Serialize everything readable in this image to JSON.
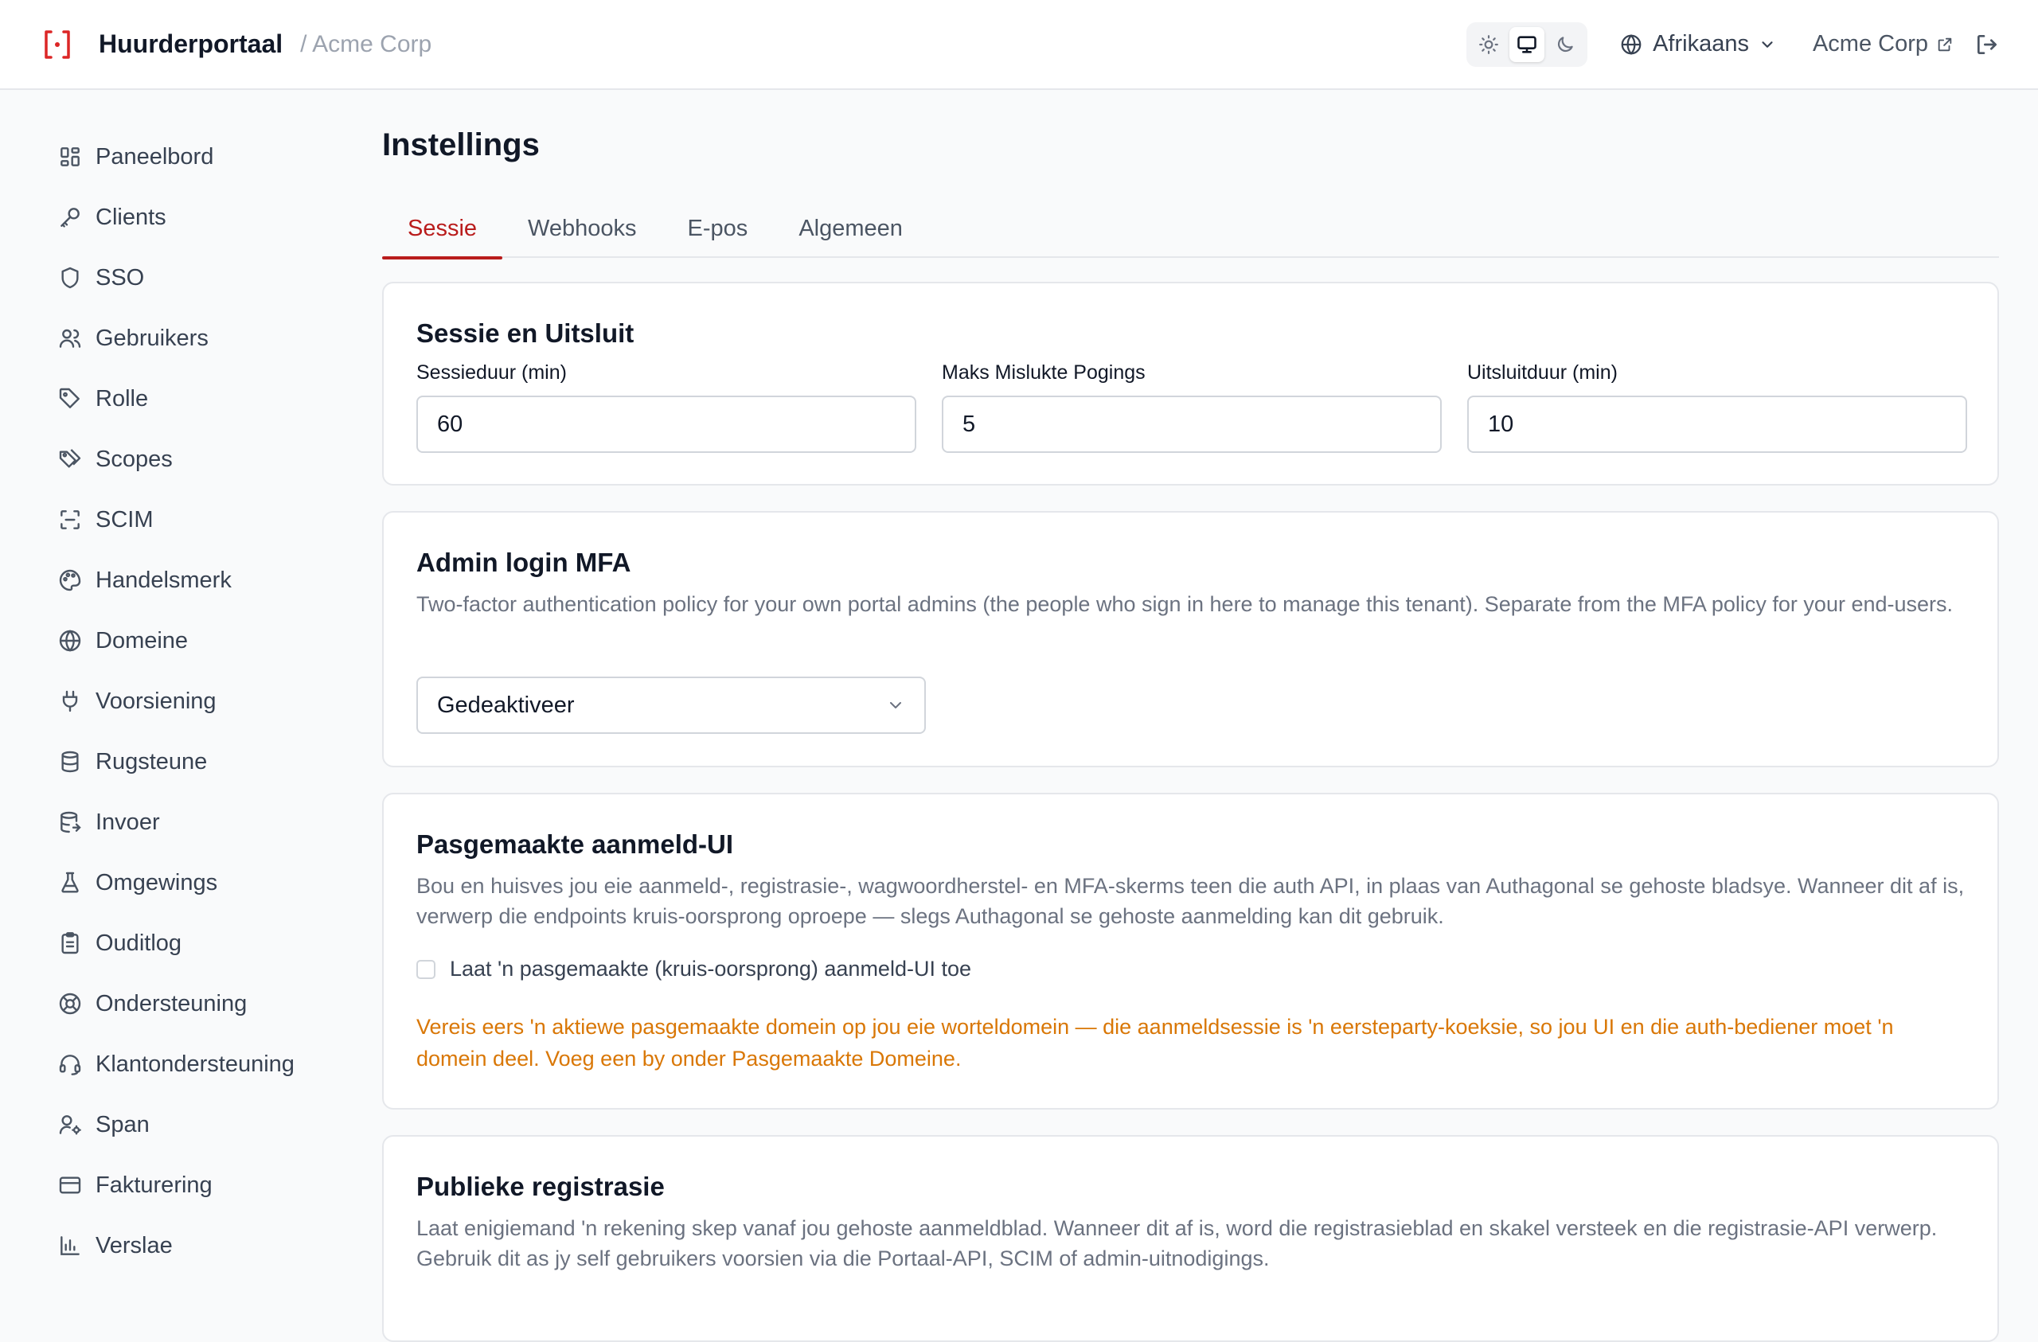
{
  "header": {
    "app_title": "Huurderportaal",
    "tenant_crumb": "/ Acme Corp",
    "theme_options": [
      "light",
      "system",
      "dark"
    ],
    "theme_active": "system",
    "language": "Afrikaans",
    "tenant_link": "Acme Corp"
  },
  "colors": {
    "accent": "#b91c1c",
    "warning": "#d97706"
  },
  "sidebar": {
    "items": [
      {
        "label": "Paneelbord",
        "icon": "dashboard-icon"
      },
      {
        "label": "Clients",
        "icon": "key-icon"
      },
      {
        "label": "SSO",
        "icon": "shield-icon"
      },
      {
        "label": "Gebruikers",
        "icon": "users-icon"
      },
      {
        "label": "Rolle",
        "icon": "tag-icon"
      },
      {
        "label": "Scopes",
        "icon": "tags-icon"
      },
      {
        "label": "SCIM",
        "icon": "scan-icon"
      },
      {
        "label": "Handelsmerk",
        "icon": "palette-icon"
      },
      {
        "label": "Domeine",
        "icon": "globe-icon"
      },
      {
        "label": "Voorsiening",
        "icon": "plug-icon"
      },
      {
        "label": "Rugsteune",
        "icon": "database-icon"
      },
      {
        "label": "Invoer",
        "icon": "database-import-icon"
      },
      {
        "label": "Omgewings",
        "icon": "flask-icon"
      },
      {
        "label": "Ouditlog",
        "icon": "clipboard-icon"
      },
      {
        "label": "Ondersteuning",
        "icon": "lifebuoy-icon"
      },
      {
        "label": "Klantondersteuning",
        "icon": "headset-icon"
      },
      {
        "label": "Span",
        "icon": "user-cog-icon"
      },
      {
        "label": "Fakturering",
        "icon": "credit-card-icon"
      },
      {
        "label": "Verslae",
        "icon": "bar-chart-icon"
      }
    ]
  },
  "main": {
    "title": "Instellings",
    "tabs": [
      {
        "label": "Sessie",
        "active": true
      },
      {
        "label": "Webhooks",
        "active": false
      },
      {
        "label": "E-pos",
        "active": false
      },
      {
        "label": "Algemeen",
        "active": false
      }
    ],
    "session": {
      "title": "Sessie en Uitsluit",
      "fields": [
        {
          "label": "Sessieduur (min)",
          "value": "60"
        },
        {
          "label": "Maks Mislukte Pogings",
          "value": "5"
        },
        {
          "label": "Uitsluitduur (min)",
          "value": "10"
        }
      ]
    },
    "mfa": {
      "title": "Admin login MFA",
      "description": "Two-factor authentication policy for your own portal admins (the people who sign in here to manage this tenant). Separate from the MFA policy for your end-users.",
      "selected": "Gedeaktiveer"
    },
    "custom_login": {
      "title": "Pasgemaakte aanmeld-UI",
      "description": "Bou en huisves jou eie aanmeld-, registrasie-, wagwoordherstel- en MFA-skerms teen die auth API, in plaas van Authagonal se gehoste bladsye. Wanneer dit af is, verwerp die endpoints kruis-oorsprong oproepe — slegs Authagonal se gehoste aanmelding kan dit gebruik.",
      "checkbox_label": "Laat 'n pasgemaakte (kruis-oorsprong) aanmeld-UI toe",
      "warning": "Vereis eers 'n aktiewe pasgemaakte domein op jou eie worteldomein — die aanmeldsessie is 'n eersteparty-koeksie, so jou UI en die auth-bediener moet 'n domein deel. Voeg een by onder Pasgemaakte Domeine."
    },
    "public_registration": {
      "title": "Publieke registrasie",
      "description": "Laat enigiemand 'n rekening skep vanaf jou gehoste aanmeldblad. Wanneer dit af is, word die registrasieblad en skakel versteek en die registrasie-API verwerp. Gebruik dit as jy self gebruikers voorsien via die Portaal-API, SCIM of admin-uitnodigings."
    }
  }
}
